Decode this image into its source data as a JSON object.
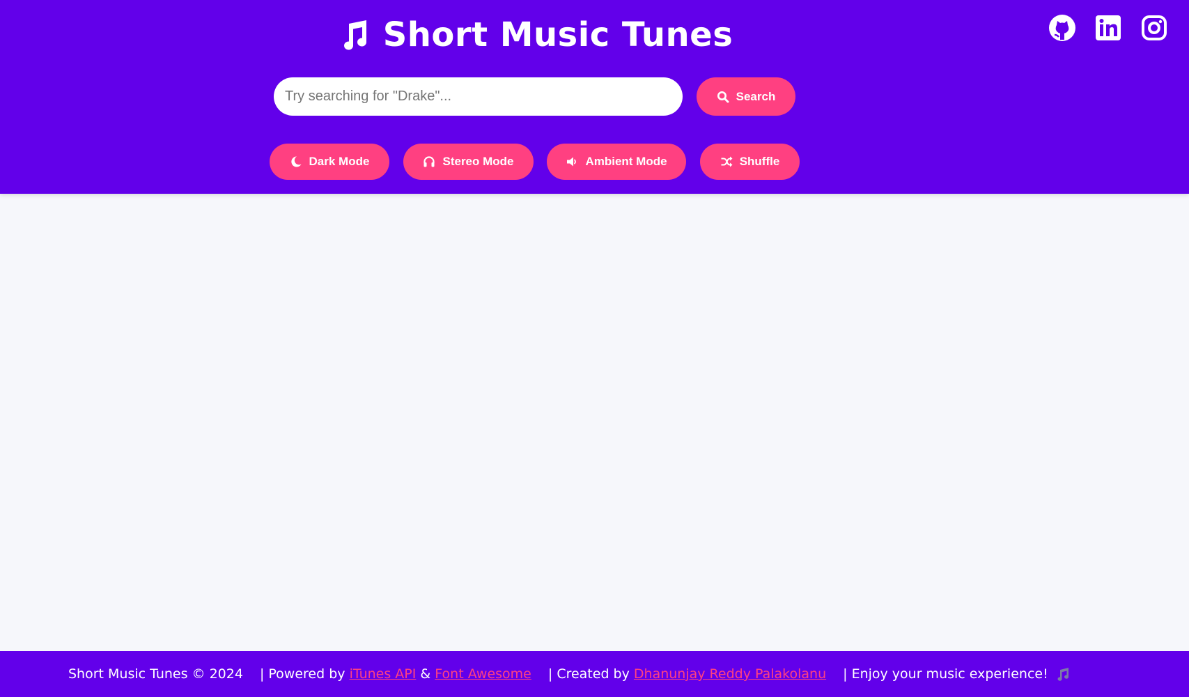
{
  "header": {
    "title": "Short Music Tunes",
    "title_icon": "music-note-icon",
    "social": [
      {
        "name": "github-icon"
      },
      {
        "name": "linkedin-icon"
      },
      {
        "name": "instagram-icon"
      }
    ]
  },
  "search": {
    "placeholder": "Try searching for \"Drake\"...",
    "value": "",
    "button_label": "Search",
    "button_icon": "search-icon"
  },
  "modes": {
    "dark": "Dark Mode",
    "stereo": "Stereo Mode",
    "ambient": "Ambient Mode",
    "shuffle": "Shuffle"
  },
  "footer": {
    "copyright": "Short Music Tunes © 2024",
    "powered_prefix": "| Powered by",
    "itunes_link": "iTunes API",
    "amp": "&",
    "fontawesome_link": "Font Awesome",
    "created_prefix": "| Created by",
    "author_link": "Dhanunjay Reddy Palakolanu",
    "enjoy": "| Enjoy your music experience!"
  },
  "colors": {
    "header_bg": "#6200ea",
    "accent": "#ff4081",
    "page_bg": "#f6f7fb"
  }
}
